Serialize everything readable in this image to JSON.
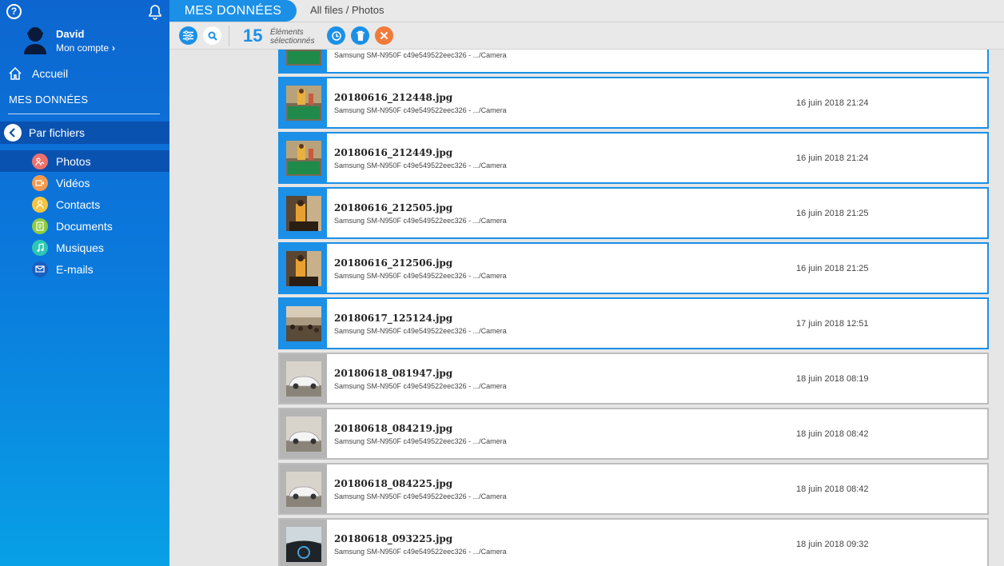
{
  "app": {
    "header_title": "MES DONNÉES",
    "breadcrumb": "All files / Photos"
  },
  "sidebar": {
    "help_icon": "?",
    "user_name": "David",
    "account_link": "Mon compte",
    "home": "Accueil",
    "section_title": "MES DONNÉES",
    "par_fichiers": "Par fichiers",
    "categories": [
      {
        "label": "Photos",
        "icon": "photo-icon",
        "color": "#f0716b",
        "active": true
      },
      {
        "label": "Vidéos",
        "icon": "video-icon",
        "color": "#f79a4c",
        "active": false
      },
      {
        "label": "Contacts",
        "icon": "contact-icon",
        "color": "#f5c542",
        "active": false
      },
      {
        "label": "Documents",
        "icon": "document-icon",
        "color": "#8ccc3f",
        "active": false
      },
      {
        "label": "Musiques",
        "icon": "music-icon",
        "color": "#2ec7b4",
        "active": false
      },
      {
        "label": "E-mails",
        "icon": "email-icon",
        "color": "#1a5fbf",
        "active": false
      }
    ]
  },
  "toolbar": {
    "selected_count": "15",
    "selected_label_line1": "Éléments",
    "selected_label_line2": "sélectionnés"
  },
  "colors": {
    "accent": "#1b90e6",
    "cancel": "#f27b3b"
  },
  "files": [
    {
      "name": "",
      "source": "Samsung SM-N950F c49e549522eec326 - .../Camera",
      "date": "",
      "selected": true,
      "thumb": "billiard"
    },
    {
      "name": "20180616_212448.jpg",
      "source": "Samsung SM-N950F c49e549522eec326 - .../Camera",
      "date": "16 juin 2018 21:24",
      "selected": true,
      "thumb": "billiard"
    },
    {
      "name": "20180616_212449.jpg",
      "source": "Samsung SM-N950F c49e549522eec326 - .../Camera",
      "date": "16 juin 2018 21:24",
      "selected": true,
      "thumb": "billiard"
    },
    {
      "name": "20180616_212505.jpg",
      "source": "Samsung SM-N950F c49e549522eec326 - .../Camera",
      "date": "16 juin 2018 21:25",
      "selected": true,
      "thumb": "indoor"
    },
    {
      "name": "20180616_212506.jpg",
      "source": "Samsung SM-N950F c49e549522eec326 - .../Camera",
      "date": "16 juin 2018 21:25",
      "selected": true,
      "thumb": "indoor"
    },
    {
      "name": "20180617_125124.jpg",
      "source": "Samsung SM-N950F c49e549522eec326 - .../Camera",
      "date": "17 juin 2018 12:51",
      "selected": true,
      "thumb": "crowd"
    },
    {
      "name": "20180618_081947.jpg",
      "source": "Samsung SM-N950F c49e549522eec326 - .../Camera",
      "date": "18 juin 2018 08:19",
      "selected": false,
      "thumb": "car"
    },
    {
      "name": "20180618_084219.jpg",
      "source": "Samsung SM-N950F c49e549522eec326 - .../Camera",
      "date": "18 juin 2018 08:42",
      "selected": false,
      "thumb": "car"
    },
    {
      "name": "20180618_084225.jpg",
      "source": "Samsung SM-N950F c49e549522eec326 - .../Camera",
      "date": "18 juin 2018 08:42",
      "selected": false,
      "thumb": "car"
    },
    {
      "name": "20180618_093225.jpg",
      "source": "Samsung SM-N950F c49e549522eec326 - .../Camera",
      "date": "18 juin 2018 09:32",
      "selected": false,
      "thumb": "dashboard"
    }
  ]
}
